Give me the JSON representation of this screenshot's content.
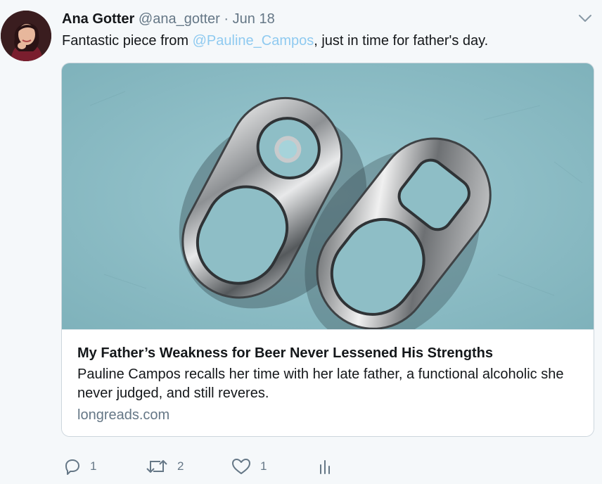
{
  "tweet": {
    "author_name": "Ana Gotter",
    "handle": "@ana_gotter",
    "separator": "·",
    "date": "Jun 18",
    "text_before": "Fantastic piece from ",
    "mention": "@Pauline_Campos",
    "text_after": ", just in time for father's day."
  },
  "card": {
    "title": "My Father’s Weakness for Beer Never Lessened His Strengths",
    "description": "Pauline Campos recalls her time with her late father, a functional alcoholic she never judged, and still reveres.",
    "domain": "longreads.com",
    "image_icon": "linked-can-tabs-image"
  },
  "actions": {
    "reply_count": "1",
    "retweet_count": "2",
    "like_count": "1"
  },
  "colors": {
    "mention": "#8fcaf0",
    "meta": "#657786",
    "card_image_bg": "#8ebec6"
  }
}
